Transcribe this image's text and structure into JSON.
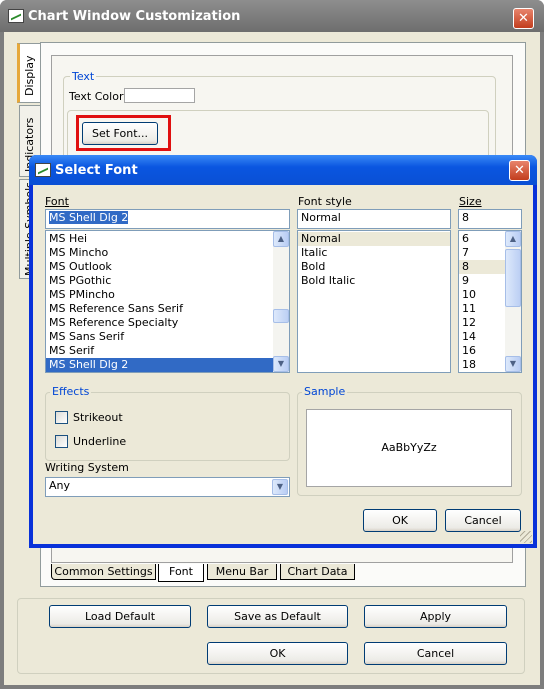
{
  "main_window": {
    "title": "Chart Window Customization",
    "side_tabs": [
      "Display",
      "Indicators",
      "Multiple Symbols"
    ],
    "text_group_title": "Text",
    "text_color_label": "Text Color",
    "set_font_button": "Set Font...",
    "bottom_tabs": [
      "Common Settings",
      "Font",
      "Menu Bar",
      "Chart Data"
    ],
    "selected_bottom_tab": "Font",
    "buttons": {
      "load_default": "Load Default",
      "save_as_default": "Save as Default",
      "apply": "Apply",
      "ok": "OK",
      "cancel": "Cancel"
    }
  },
  "font_dialog": {
    "title": "Select Font",
    "font_label": "Font",
    "font_value": "MS Shell Dlg 2",
    "font_list": [
      "MS Hei",
      "MS Mincho",
      "MS Outlook",
      "MS PGothic",
      "MS PMincho",
      "MS Reference Sans Serif",
      "MS Reference Specialty",
      "MS Sans Serif",
      "MS Serif",
      "MS Shell Dlg 2"
    ],
    "selected_font": "MS Shell Dlg 2",
    "style_label": "Font style",
    "style_value": "Normal",
    "style_list": [
      "Normal",
      "Italic",
      "Bold",
      "Bold Italic"
    ],
    "selected_style": "Normal",
    "size_label": "Size",
    "size_value": "8",
    "size_list": [
      "6",
      "7",
      "8",
      "9",
      "10",
      "11",
      "12",
      "14",
      "16",
      "18"
    ],
    "selected_size": "8",
    "effects_title": "Effects",
    "strikeout_label": "Strikeout",
    "strikeout_checked": false,
    "underline_label": "Underline",
    "underline_checked": false,
    "writing_system_label": "Writing System",
    "writing_system_value": "Any",
    "sample_title": "Sample",
    "sample_text": "AaBbYyZz",
    "ok_button": "OK",
    "cancel_button": "Cancel"
  },
  "colors": {
    "main_titlebar": "#7c7c7c",
    "dialog_titlebar": "#0a56e0",
    "dialog_frame": "#0831d9",
    "face": "#ece9d8",
    "selection": "#316ac5",
    "highlight_box": "#e01010",
    "group_title": "#0046d5"
  }
}
